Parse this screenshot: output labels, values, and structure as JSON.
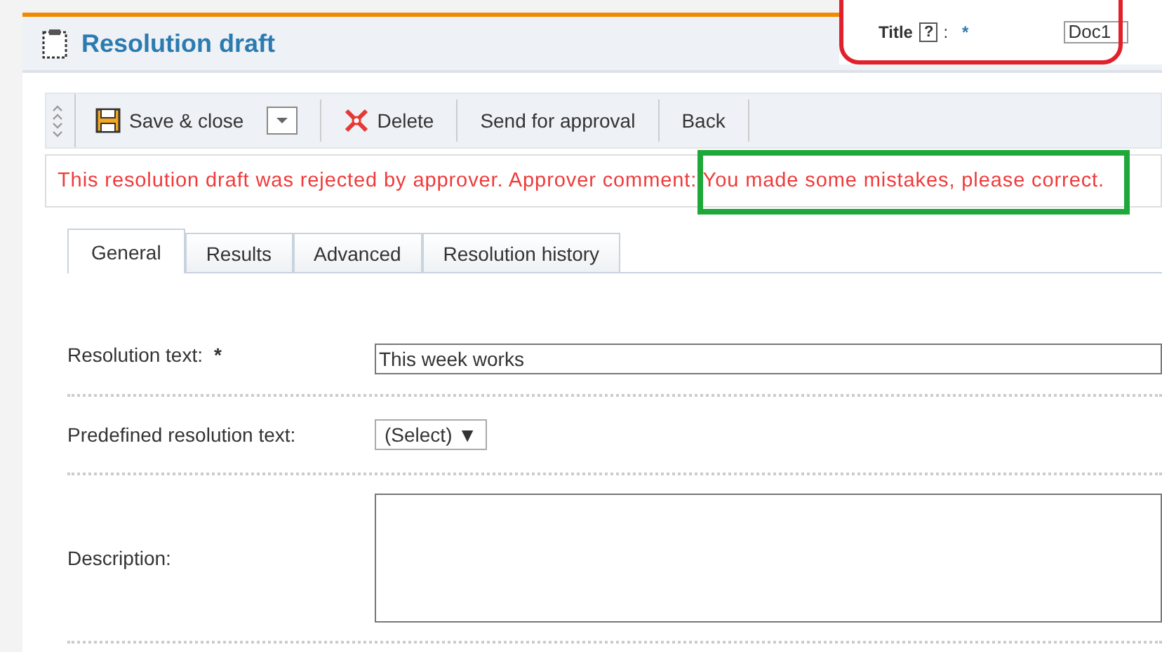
{
  "header": {
    "title": "Resolution draft"
  },
  "inset": {
    "label": "Title",
    "help": "?",
    "separator": ":",
    "required": "*",
    "value": "Doc1"
  },
  "toolbar": {
    "buttons": [
      {
        "kind": "save",
        "label": "Save & close"
      },
      {
        "kind": "dropdown"
      },
      {
        "kind": "delete",
        "label": "Delete"
      },
      {
        "kind": "plain",
        "label": "Send for approval"
      },
      {
        "kind": "plain",
        "label": "Back"
      }
    ]
  },
  "message": {
    "text": "This resolution draft was rejected by approver. Approver comment: ",
    "comment": "You made some mistakes, please correct."
  },
  "tabs": [
    {
      "label": "General",
      "selected": true
    },
    {
      "label": "Results",
      "selected": false
    },
    {
      "label": "Advanced",
      "selected": false
    },
    {
      "label": "Resolution history",
      "selected": false
    }
  ],
  "form": {
    "rows": [
      {
        "kind": "text",
        "label": "Resolution text:",
        "required": "*",
        "value": "This week works"
      },
      {
        "kind": "select",
        "label": "Predefined resolution text:",
        "value": "(Select)",
        "arrow": "▼"
      },
      {
        "kind": "textarea",
        "label": "Description:"
      }
    ]
  }
}
